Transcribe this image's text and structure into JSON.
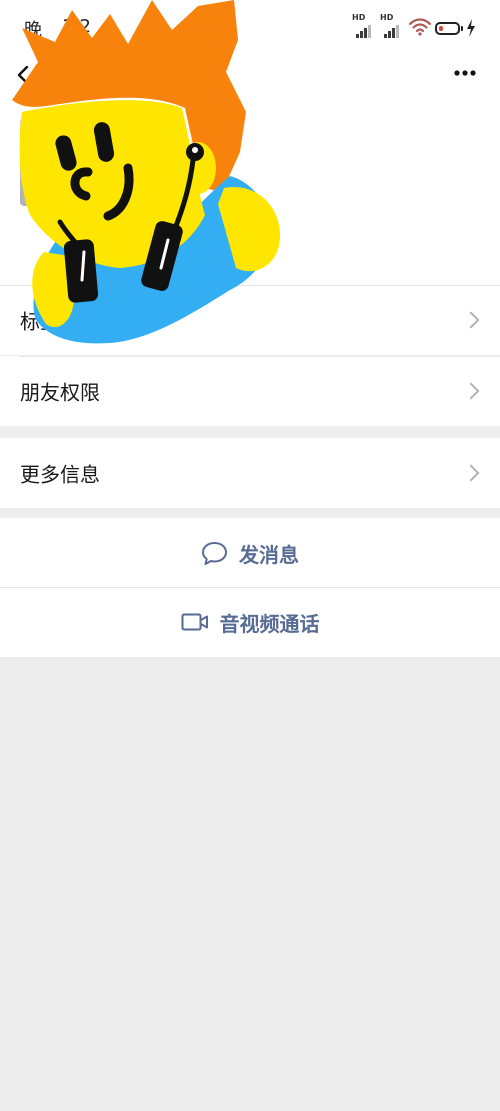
{
  "status_bar": {
    "time_part1": "晚",
    "time_part2": "1:2",
    "signal_1_label": "HD",
    "signal_2_label": "HD",
    "wifi_icon": "wifi-icon",
    "battery_level": 0.25,
    "charging_icon": "lightning-bolt-icon"
  },
  "header": {
    "back_icon": "chevron-left-icon",
    "more_icon": "more-dots-icon"
  },
  "settings_rows": [
    {
      "label": "标签"
    },
    {
      "label": "朋友权限"
    }
  ],
  "more_info": {
    "label": "更多信息"
  },
  "actions": [
    {
      "label": "发消息",
      "icon": "chat-bubble-icon"
    },
    {
      "label": "音视频通话",
      "icon": "video-call-icon"
    }
  ],
  "colors": {
    "link": "#576b95",
    "text": "#191919",
    "page_background": "#ededed",
    "card_background": "#ffffff",
    "chevron": "#b2b2b2",
    "battery_low": "#e0403a"
  }
}
